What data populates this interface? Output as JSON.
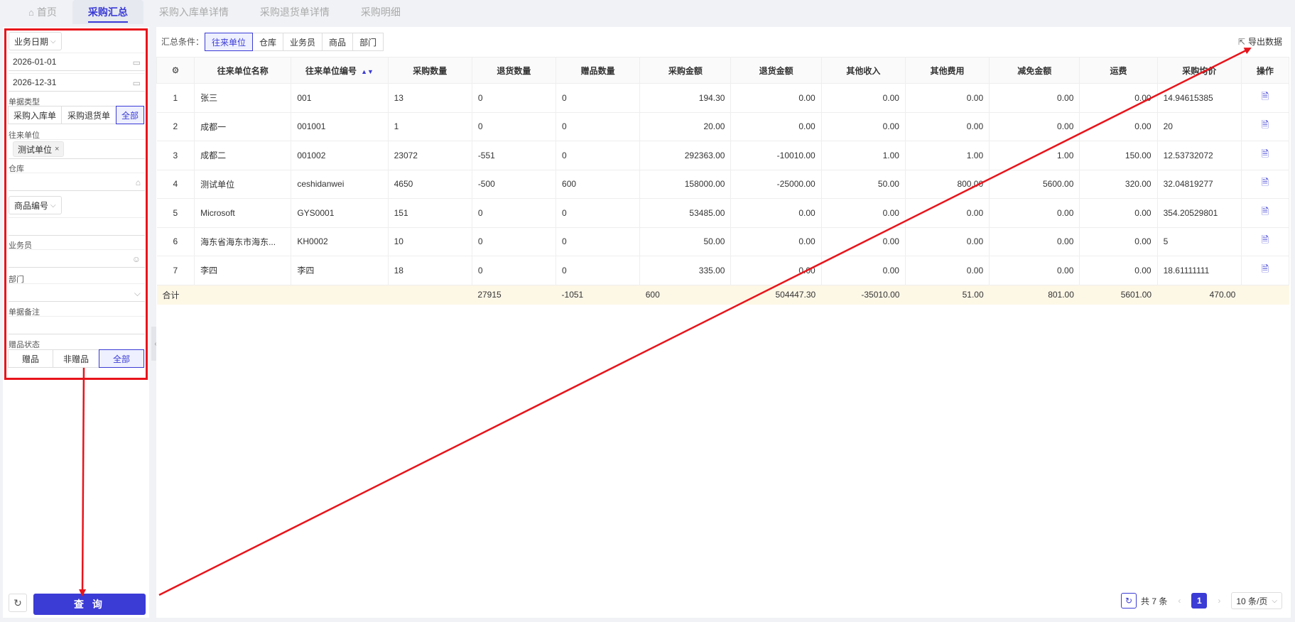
{
  "tabs": [
    {
      "label": "首页"
    },
    {
      "label": "采购汇总"
    },
    {
      "label": "采购入库单详情"
    },
    {
      "label": "采购退货单详情"
    },
    {
      "label": "采购明细"
    }
  ],
  "filters": {
    "date_type": "业务日期",
    "date_start": "2026-01-01",
    "date_end": "2026-12-31",
    "doc_type_label": "单据类型",
    "doc_types": [
      "采购入库单",
      "采购退货单",
      "全部"
    ],
    "partner_label": "往来单位",
    "partner_tag": "测试单位",
    "warehouse_label": "仓库",
    "product_select": "商品编号",
    "salesman_label": "业务员",
    "department_label": "部门",
    "remark_label": "单据备注",
    "gift_status_label": "赠品状态",
    "gift_options": [
      "赠品",
      "非赠品",
      "全部"
    ],
    "query_label": "查 询"
  },
  "main": {
    "condition_label": "汇总条件：",
    "conditions": [
      "往来单位",
      "仓库",
      "业务员",
      "商品",
      "部门"
    ],
    "export_label": "导出数据"
  },
  "table": {
    "headers": [
      "往来单位名称",
      "往来单位编号",
      "采购数量",
      "退货数量",
      "赠品数量",
      "采购金额",
      "退货金额",
      "其他收入",
      "其他费用",
      "减免金额",
      "运费",
      "采购均价",
      "操作"
    ],
    "rows": [
      [
        "1",
        "张三",
        "001",
        "13",
        "0",
        "0",
        "194.30",
        "0.00",
        "0.00",
        "0.00",
        "0.00",
        "0.00",
        "14.94615385"
      ],
      [
        "2",
        "成都一",
        "001001",
        "1",
        "0",
        "0",
        "20.00",
        "0.00",
        "0.00",
        "0.00",
        "0.00",
        "0.00",
        "20"
      ],
      [
        "3",
        "成都二",
        "001002",
        "23072",
        "-551",
        "0",
        "292363.00",
        "-10010.00",
        "1.00",
        "1.00",
        "1.00",
        "150.00",
        "12.53732072"
      ],
      [
        "4",
        "测试单位",
        "ceshidanwei",
        "4650",
        "-500",
        "600",
        "158000.00",
        "-25000.00",
        "50.00",
        "800.00",
        "5600.00",
        "320.00",
        "32.04819277"
      ],
      [
        "5",
        "Microsoft",
        "GYS0001",
        "151",
        "0",
        "0",
        "53485.00",
        "0.00",
        "0.00",
        "0.00",
        "0.00",
        "0.00",
        "354.20529801"
      ],
      [
        "6",
        "海东省海东市海东...",
        "KH0002",
        "10",
        "0",
        "0",
        "50.00",
        "0.00",
        "0.00",
        "0.00",
        "0.00",
        "0.00",
        "5"
      ],
      [
        "7",
        "李四",
        "李四",
        "18",
        "0",
        "0",
        "335.00",
        "0.00",
        "0.00",
        "0.00",
        "0.00",
        "0.00",
        "18.61111111"
      ]
    ],
    "total": [
      "合计",
      "",
      "",
      "27915",
      "-1051",
      "600",
      "504447.30",
      "-35010.00",
      "51.00",
      "801.00",
      "5601.00",
      "470.00",
      ""
    ]
  },
  "pager": {
    "total_text": "共 7 条",
    "current_page": "1",
    "page_size": "10 条/页"
  },
  "colors": {
    "accent": "#3b3bd6",
    "annotation": "#e8141b",
    "total_row": "#fdf7e6"
  }
}
